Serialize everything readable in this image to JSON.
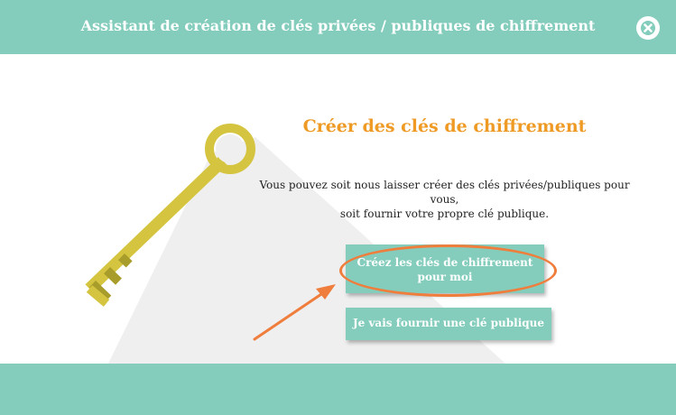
{
  "header": {
    "title": "Assistant de création de clés privées / publiques de chiffrement",
    "close_icon": "close-icon"
  },
  "main": {
    "title": "Créer des clés de chiffrement",
    "description_line1": "Vous pouvez soit nous laisser créer des clés privées/publiques pour vous,",
    "description_line2": "soit fournir votre propre clé publique.",
    "create_button_label": "Créez les clés de chiffrement pour moi",
    "provide_button_label": "Je vais fournir une clé publique"
  },
  "illustration": {
    "icon": "key-icon",
    "annotation": "arrow-icon"
  },
  "colors": {
    "accent": "#84cdbc",
    "title": "#ee9a24",
    "highlight": "#ef7d3c",
    "key": "#d4c440"
  }
}
